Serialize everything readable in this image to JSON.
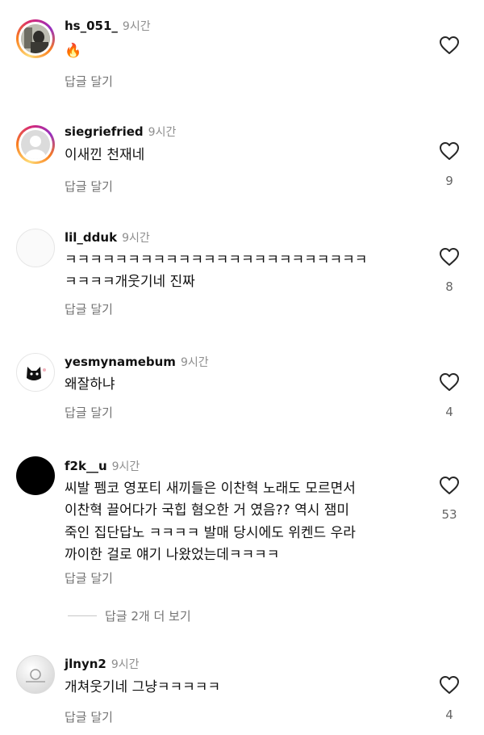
{
  "comments": [
    {
      "username": "hs_051_",
      "time": "9시간",
      "text": "🔥",
      "reply": "답글 달기",
      "likes": ""
    },
    {
      "username": "siegriefried",
      "time": "9시간",
      "text": "이새낀 천재네",
      "reply": "답글 달기",
      "likes": "9"
    },
    {
      "username": "lil_dduk",
      "time": "9시간",
      "text_lines": [
        "ㅋㅋㅋㅋㅋㅋㅋㅋㅋㅋㅋㅋㅋㅋㅋㅋㅋㅋㅋㅋㅋㅋㅋㅋ",
        "ㅋㅋㅋㅋ개웃기네 진짜"
      ],
      "reply": "답글 달기",
      "likes": "8"
    },
    {
      "username": "yesmynamebum",
      "time": "9시간",
      "text": "왜잘하냐",
      "reply": "답글 달기",
      "likes": "4"
    },
    {
      "username": "f2k__u",
      "time": "9시간",
      "text_lines": [
        "씨발 펨코 영포티 새끼들은 이찬혁 노래도 모르면서",
        "이찬혁 끌어다가 국힙 혐오한 거 였음?? 역시 잼미",
        "죽인 집단답노 ㅋㅋㅋㅋ 발매 당시에도 위켄드 우라",
        "까이한 걸로 얘기 나왔었는데ㅋㅋㅋㅋ"
      ],
      "reply": "답글 달기",
      "likes": "53"
    },
    {
      "username": "jlnyn2",
      "time": "9시간",
      "text": "개쳐웃기네 그냥ㅋㅋㅋㅋㅋ",
      "reply": "답글 달기",
      "likes": "4"
    }
  ],
  "view_more": "답글 2개 더 보기",
  "icons": {
    "like": "heart-outline-icon"
  },
  "colors": {
    "text": "#111111",
    "secondary": "#737373",
    "story_ring": "#d62976"
  }
}
